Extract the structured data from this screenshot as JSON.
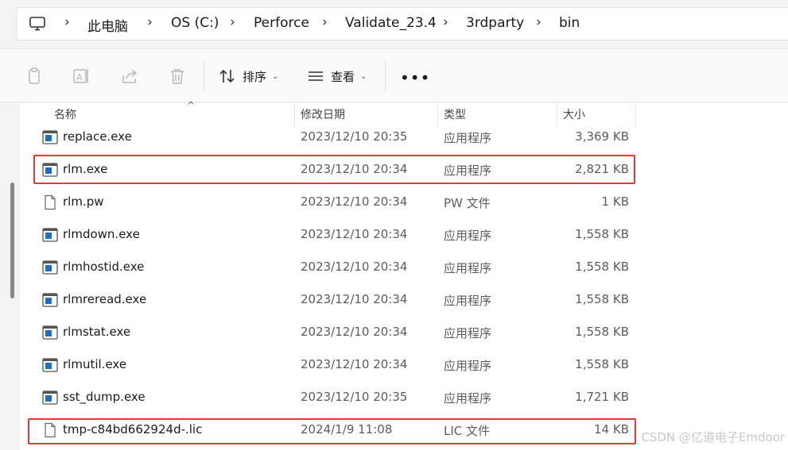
{
  "breadcrumb": {
    "items": [
      "此电脑",
      "OS (C:)",
      "Perforce",
      "Validate_23.4",
      "3rdparty",
      "bin"
    ],
    "separator": "›"
  },
  "toolbar": {
    "sort_label": "排序",
    "view_label": "查看",
    "more_label": "•••",
    "icons": [
      "copy-icon",
      "rename-icon",
      "share-icon",
      "delete-icon",
      "sort-icon",
      "view-icon"
    ]
  },
  "columns": {
    "name": "名称",
    "date": "修改日期",
    "type": "类型",
    "size": "大小"
  },
  "files": [
    {
      "name": "replace.exe",
      "date": "2023/12/10 20:35",
      "type": "应用程序",
      "size": "3,369 KB",
      "icon": "exe-icon",
      "highlighted": false
    },
    {
      "name": "rlm.exe",
      "date": "2023/12/10 20:34",
      "type": "应用程序",
      "size": "2,821 KB",
      "icon": "exe-icon",
      "highlighted": true
    },
    {
      "name": "rlm.pw",
      "date": "2023/12/10 20:34",
      "type": "PW 文件",
      "size": "1 KB",
      "icon": "file-icon",
      "highlighted": false
    },
    {
      "name": "rlmdown.exe",
      "date": "2023/12/10 20:34",
      "type": "应用程序",
      "size": "1,558 KB",
      "icon": "exe-icon",
      "highlighted": false
    },
    {
      "name": "rlmhostid.exe",
      "date": "2023/12/10 20:34",
      "type": "应用程序",
      "size": "1,558 KB",
      "icon": "exe-icon",
      "highlighted": false
    },
    {
      "name": "rlmreread.exe",
      "date": "2023/12/10 20:34",
      "type": "应用程序",
      "size": "1,558 KB",
      "icon": "exe-icon",
      "highlighted": false
    },
    {
      "name": "rlmstat.exe",
      "date": "2023/12/10 20:34",
      "type": "应用程序",
      "size": "1,558 KB",
      "icon": "exe-icon",
      "highlighted": false
    },
    {
      "name": "rlmutil.exe",
      "date": "2023/12/10 20:34",
      "type": "应用程序",
      "size": "1,558 KB",
      "icon": "exe-icon",
      "highlighted": false
    },
    {
      "name": "sst_dump.exe",
      "date": "2023/12/10 20:35",
      "type": "应用程序",
      "size": "1,721 KB",
      "icon": "exe-icon",
      "highlighted": false
    },
    {
      "name": "tmp-c84bd662924d-.lic",
      "date": "2024/1/9 11:08",
      "type": "LIC 文件",
      "size": "14 KB",
      "icon": "file-icon",
      "highlighted": true
    }
  ],
  "watermark": "CSDN @亿道电子Emdoor",
  "colors": {
    "highlight": "#e53935",
    "exe_blue": "#1e6fc4"
  }
}
